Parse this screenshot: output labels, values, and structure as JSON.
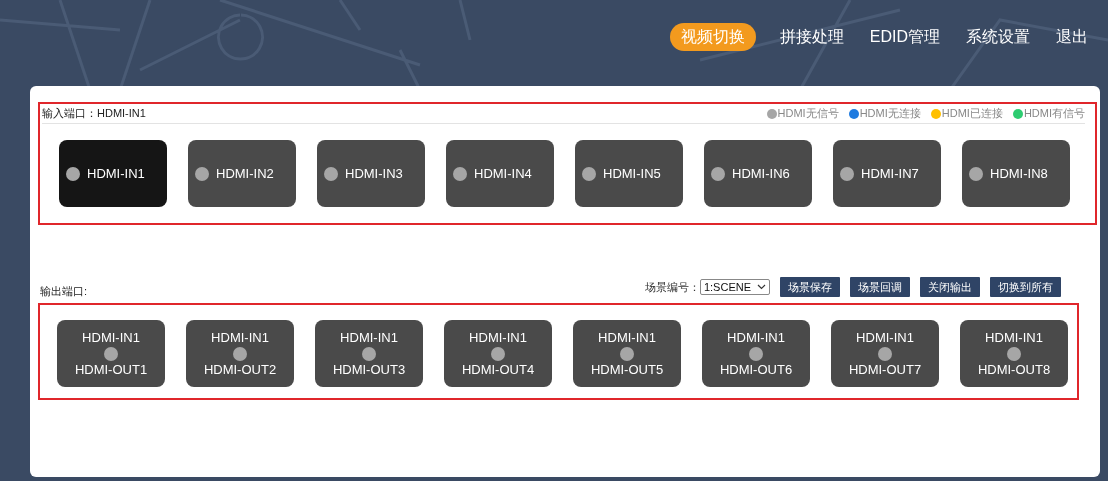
{
  "nav": [
    {
      "label": "视频切换",
      "selected": true
    },
    {
      "label": "拼接处理",
      "selected": false
    },
    {
      "label": "EDID管理",
      "selected": false
    },
    {
      "label": "系统设置",
      "selected": false
    },
    {
      "label": "退出",
      "selected": false
    }
  ],
  "input_panel": {
    "title": "输入端口：HDMI-IN1",
    "legend": [
      {
        "label": "HDMI无信号",
        "color": "#a6a6a6"
      },
      {
        "label": "HDMI无连接",
        "color": "#1e7be0"
      },
      {
        "label": "HDMI已连接",
        "color": "#ffc000"
      },
      {
        "label": "HDMI有信号",
        "color": "#2ecc71"
      }
    ],
    "ports": [
      {
        "label": "HDMI-IN1",
        "selected": true,
        "color": "#a6a6a6"
      },
      {
        "label": "HDMI-IN2",
        "selected": false,
        "color": "#a6a6a6"
      },
      {
        "label": "HDMI-IN3",
        "selected": false,
        "color": "#a6a6a6"
      },
      {
        "label": "HDMI-IN4",
        "selected": false,
        "color": "#a6a6a6"
      },
      {
        "label": "HDMI-IN5",
        "selected": false,
        "color": "#a6a6a6"
      },
      {
        "label": "HDMI-IN6",
        "selected": false,
        "color": "#a6a6a6"
      },
      {
        "label": "HDMI-IN7",
        "selected": false,
        "color": "#a6a6a6"
      },
      {
        "label": "HDMI-IN8",
        "selected": false,
        "color": "#a6a6a6"
      }
    ]
  },
  "output_panel": {
    "title": "输出端口:",
    "scene_label": "场景编号：",
    "scene_select": "1:SCENE",
    "buttons": [
      "场景保存",
      "场景回调",
      "关闭输出",
      "切换到所有"
    ],
    "ports": [
      {
        "source": "HDMI-IN1",
        "label": "HDMI-OUT1",
        "color": "#a6a6a6"
      },
      {
        "source": "HDMI-IN1",
        "label": "HDMI-OUT2",
        "color": "#a6a6a6"
      },
      {
        "source": "HDMI-IN1",
        "label": "HDMI-OUT3",
        "color": "#a6a6a6"
      },
      {
        "source": "HDMI-IN1",
        "label": "HDMI-OUT4",
        "color": "#a6a6a6"
      },
      {
        "source": "HDMI-IN1",
        "label": "HDMI-OUT5",
        "color": "#a6a6a6"
      },
      {
        "source": "HDMI-IN1",
        "label": "HDMI-OUT6",
        "color": "#a6a6a6"
      },
      {
        "source": "HDMI-IN1",
        "label": "HDMI-OUT7",
        "color": "#a6a6a6"
      },
      {
        "source": "HDMI-IN1",
        "label": "HDMI-OUT8",
        "color": "#a6a6a6"
      }
    ]
  }
}
